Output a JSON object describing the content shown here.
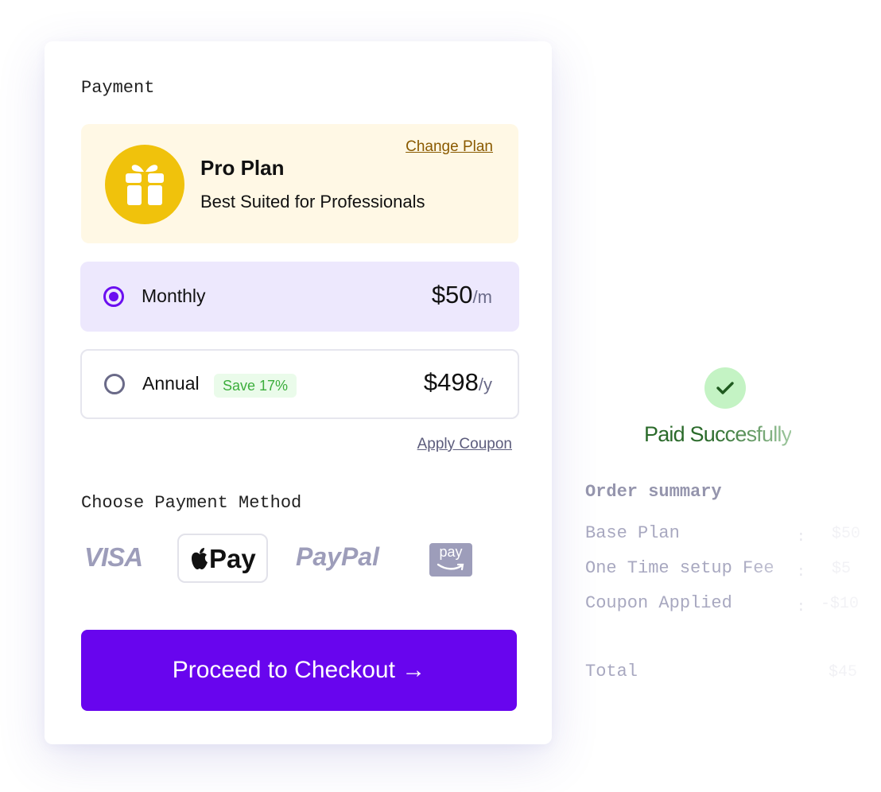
{
  "payment": {
    "heading": "Payment",
    "plan": {
      "icon": "gift-icon",
      "name": "Pro Plan",
      "description": "Best Suited for Professionals",
      "change_label": "Change Plan"
    },
    "billing_options": [
      {
        "label": "Monthly",
        "price": "$50",
        "unit": "/m",
        "selected": true
      },
      {
        "label": "Annual",
        "badge": "Save 17%",
        "price": "$498",
        "unit": "/y",
        "selected": false
      }
    ],
    "apply_coupon_label": "Apply Coupon",
    "method_heading": "Choose Payment Method",
    "methods": [
      {
        "name": "VISA",
        "icon": "visa-logo"
      },
      {
        "name": "Pay",
        "icon": "apple-pay-logo",
        "selected": true
      },
      {
        "name": "PayPal",
        "icon": "paypal-logo"
      },
      {
        "name": "pay",
        "icon": "amazon-pay-logo"
      }
    ],
    "checkout_label": "Proceed to Checkout →"
  },
  "success": {
    "icon": "check-icon",
    "text": "Paid Succesfully"
  },
  "order_summary": {
    "title": "Order summary",
    "rows": [
      {
        "label": "Base Plan",
        "sep": ":",
        "value": "$50"
      },
      {
        "label": "One Time setup Fee",
        "sep": ":",
        "value": "$5"
      },
      {
        "label": "Coupon Applied",
        "sep": ":",
        "value": "-$10"
      }
    ],
    "total": {
      "label": "Total",
      "value": "$45"
    }
  },
  "colors": {
    "accent": "#6805ee",
    "plan_bg": "#fff8e5",
    "plan_icon": "#f0c20c",
    "selected_option_bg": "#ede8fd",
    "success_green": "#2a6a2a",
    "save_badge_text": "#3cae3c"
  }
}
